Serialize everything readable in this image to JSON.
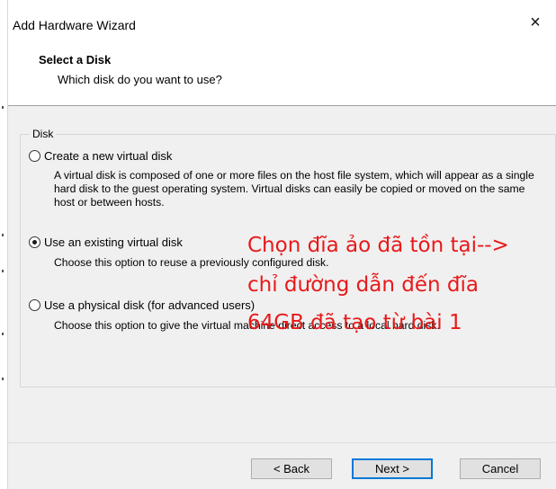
{
  "window": {
    "title": "Add Hardware Wizard",
    "close_symbol": "×"
  },
  "header": {
    "heading": "Select a Disk",
    "subheading": "Which disk do you want to use?"
  },
  "group": {
    "legend": "Disk"
  },
  "options": [
    {
      "label": "Create a new virtual disk",
      "selected": false,
      "description": "A virtual disk is composed of one or more files on the host file system, which will appear as a single hard disk to the guest operating system. Virtual disks can easily be copied or moved on the same host or between hosts."
    },
    {
      "label": "Use an existing virtual disk",
      "selected": true,
      "description": "Choose this option to reuse a previously configured disk."
    },
    {
      "label": "Use a physical disk (for advanced users)",
      "selected": false,
      "description": "Choose this option to give the virtual machine direct access to a local hard disk."
    }
  ],
  "annotation": {
    "line1": "Chọn đĩa ảo đã tồn tại-->",
    "line2": "chỉ đường dẫn đến đĩa",
    "line3": "64GB đã tạo từ bài 1",
    "color": "#e8191a"
  },
  "buttons": {
    "back": "< Back",
    "next": "Next >",
    "cancel": "Cancel"
  },
  "colors": {
    "content_bg": "#f0f0f0",
    "primary_border": "#0078d7"
  }
}
